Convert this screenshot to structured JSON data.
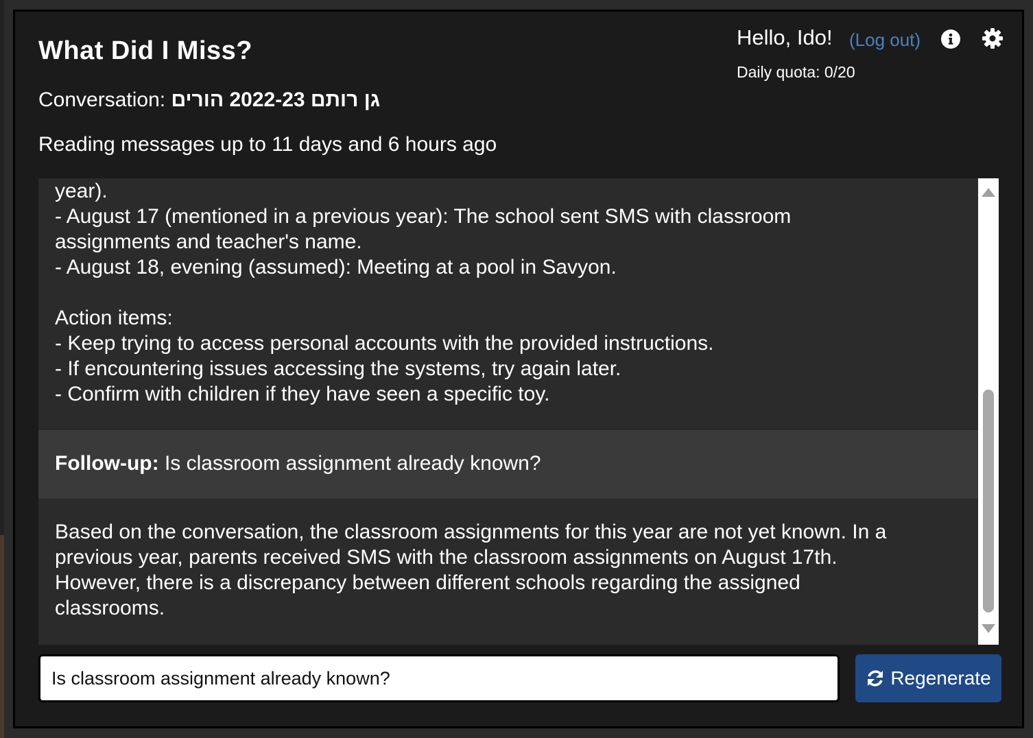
{
  "header": {
    "title": "What Did I Miss?",
    "conversation_label": "Conversation:",
    "conversation_name": "גן רותם 2022-23 הורים",
    "reading_text": "Reading messages up to 11 days and 6 hours ago",
    "greeting": "Hello, Ido!",
    "logout_label": "(Log out)",
    "quota_text": "Daily quota: 0/20",
    "info_icon": "info-icon",
    "settings_icon": "gear-icon"
  },
  "messages": {
    "summary_lines": [
      "year).",
      "- August 17 (mentioned in a previous year): The school sent SMS with classroom",
      "assignments and teacher's name.",
      "- August 18, evening (assumed): Meeting at a pool in Savyon.",
      "",
      "Action items:",
      "- Keep trying to access personal accounts with the provided instructions.",
      "- If encountering issues accessing the systems, try again later.",
      "- Confirm with children if they have seen a specific toy."
    ],
    "followup_label": "Follow-up:",
    "followup_question": " Is classroom assignment already known?",
    "answer_lines": [
      "Based on the conversation, the classroom assignments for this year are not yet known. In a",
      "previous year, parents received SMS with the classroom assignments on August 17th.",
      "However, there is a discrepancy between different schools regarding the assigned",
      "classrooms."
    ]
  },
  "input": {
    "value": "Is classroom assignment already known?",
    "regenerate_label": "Regenerate",
    "regenerate_icon": "refresh-icon"
  },
  "colors": {
    "frame_bg": "#1b1b1b",
    "panel_bg": "#2b2b2b",
    "followup_bg": "#3a3a3a",
    "link": "#4f7fc0",
    "button": "#1f4a85"
  }
}
